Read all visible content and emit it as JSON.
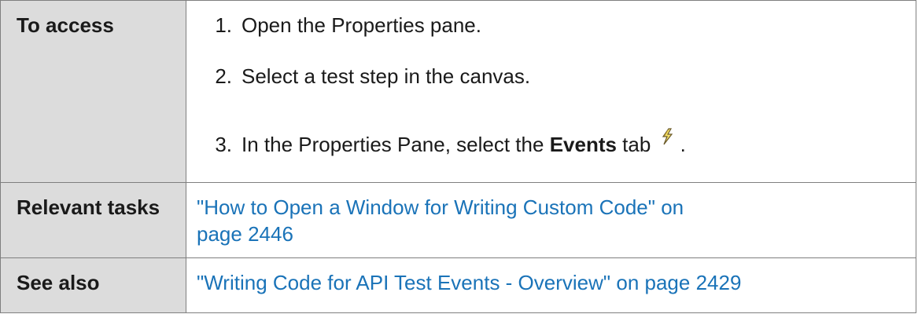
{
  "rows": {
    "access": {
      "label": "To access",
      "steps": [
        {
          "num": "1.",
          "text": "Open the Properties pane."
        },
        {
          "num": "2.",
          "text": "Select a test step in the canvas."
        },
        {
          "num": "3.",
          "text_before": "In the Properties Pane, select the ",
          "bold": "Events",
          "text_after": " tab",
          "icon": "lightning-icon",
          "end": "."
        }
      ]
    },
    "tasks": {
      "label": "Relevant tasks",
      "link_line1": "\"How to Open a Window for Writing Custom Code\" on",
      "link_line2": "page 2446"
    },
    "see_also": {
      "label": "See also",
      "link": "\"Writing Code for API Test Events - Overview\" on page 2429"
    }
  },
  "colors": {
    "label_bg": "#dcdcdc",
    "border": "#7f7f7f",
    "link": "#1a73b8"
  }
}
